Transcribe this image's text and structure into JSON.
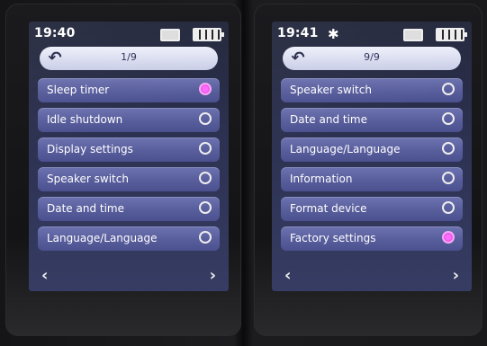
{
  "left": {
    "status": {
      "time": "19:40",
      "bluetooth": "",
      "sd_icon": "sd-card-icon",
      "battery_icon": "battery-full-icon"
    },
    "header": {
      "back_glyph": "↶",
      "page": "1/9"
    },
    "items": [
      {
        "label": "Sleep timer",
        "selected": true
      },
      {
        "label": "Idle shutdown",
        "selected": false
      },
      {
        "label": "Display settings",
        "selected": false
      },
      {
        "label": "Speaker switch",
        "selected": false
      },
      {
        "label": "Date and time",
        "selected": false
      },
      {
        "label": "Language/Language",
        "selected": false
      }
    ],
    "nav": {
      "prev": "‹",
      "next": "›"
    }
  },
  "right": {
    "status": {
      "time": "19:41",
      "bluetooth": "✱",
      "sd_icon": "sd-card-icon",
      "battery_icon": "battery-full-icon"
    },
    "header": {
      "back_glyph": "↶",
      "page": "9/9"
    },
    "items": [
      {
        "label": "Speaker switch",
        "selected": false
      },
      {
        "label": "Date and time",
        "selected": false
      },
      {
        "label": "Language/Language",
        "selected": false
      },
      {
        "label": "Information",
        "selected": false
      },
      {
        "label": "Format device",
        "selected": false
      },
      {
        "label": "Factory settings",
        "selected": true
      }
    ],
    "nav": {
      "prev": "‹",
      "next": "›"
    }
  },
  "colors": {
    "radio_selected": "#e84fe8",
    "row": "#585d9c",
    "screen": "#2c3150"
  }
}
